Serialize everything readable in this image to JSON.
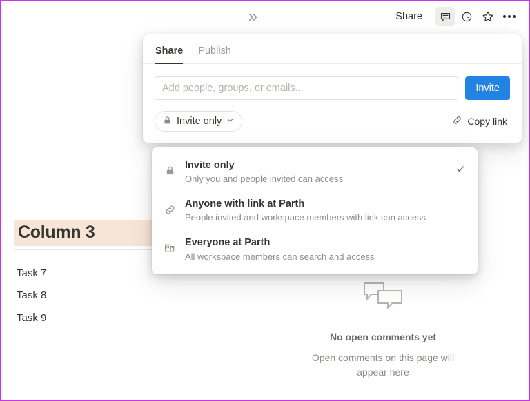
{
  "toolbar": {
    "collapse_icon": "double-chevron-right-icon",
    "share_label": "Share",
    "comment_icon": "comment-icon",
    "history_icon": "clock-icon",
    "favorite_icon": "star-icon",
    "more_icon": "more-horizontal-icon"
  },
  "document": {
    "column_heading": "Column 3",
    "heading_highlight_color": "#f7e6d7",
    "tasks": [
      "Task 7",
      "Task 8",
      "Task 9"
    ]
  },
  "comments": {
    "empty_icon": "speech-bubbles-icon",
    "empty_title": "No open comments yet",
    "empty_subtitle": "Open comments on this page will appear here"
  },
  "share_popover": {
    "tabs": [
      {
        "label": "Share",
        "active": true
      },
      {
        "label": "Publish",
        "active": false
      }
    ],
    "invite_input": {
      "value": "",
      "placeholder": "Add people, groups, or emails..."
    },
    "invite_button_label": "Invite",
    "invite_button_color": "#2383e2",
    "access_pill": {
      "icon": "lock-icon",
      "label": "Invite only",
      "chevron": "chevron-down-icon"
    },
    "copy_link": {
      "icon": "link-icon",
      "label": "Copy link"
    }
  },
  "access_menu": {
    "items": [
      {
        "icon": "lock-icon",
        "title": "Invite only",
        "description": "Only you and people invited can access",
        "selected": true
      },
      {
        "icon": "link-icon",
        "title": "Anyone with link at Parth",
        "description": "People invited and workspace members with link can access",
        "selected": false
      },
      {
        "icon": "building-icon",
        "title": "Everyone at Parth",
        "description": "All workspace members can search and access",
        "selected": false
      }
    ]
  }
}
